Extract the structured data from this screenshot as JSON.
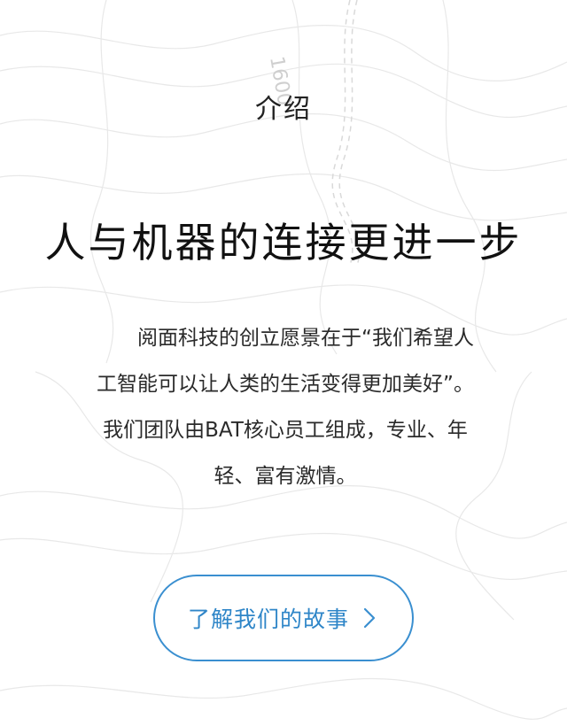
{
  "section": {
    "label": "介绍"
  },
  "hero": {
    "headline": "人与机器的连接更进一步"
  },
  "intro": {
    "lines": [
      "阅面科技的创立愿景在于“我们希望人",
      "工智能可以让人类的生活变得更加美好”。",
      "我们团队由BAT核心员工组成，专业、年",
      "轻、富有激情。"
    ]
  },
  "cta": {
    "label": "了解我们的故事",
    "icon": "chevron-right-icon"
  },
  "background": {
    "map_label": "1600"
  },
  "colors": {
    "accent": "#3a8fd0",
    "text": "#222222",
    "topo_lines": "#e6e6e6"
  }
}
